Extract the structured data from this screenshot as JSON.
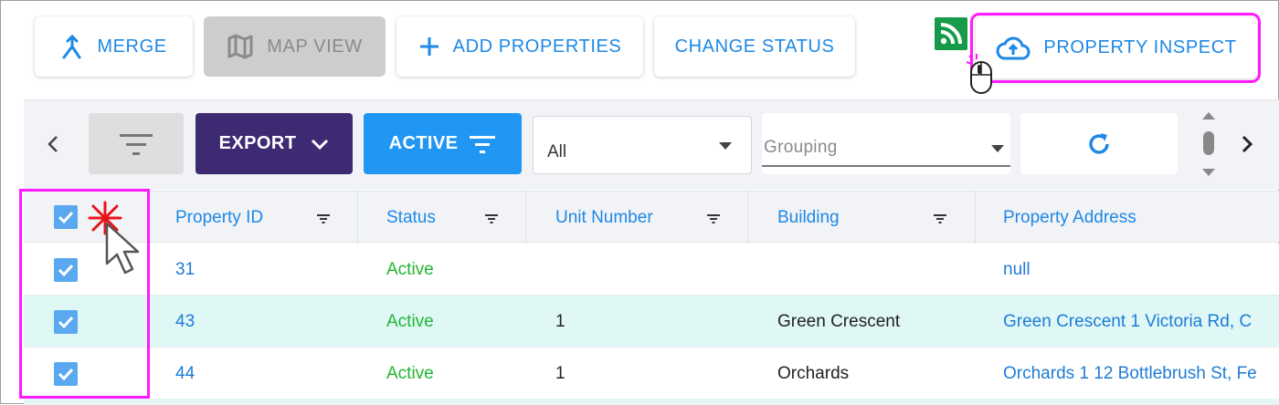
{
  "top_actions": {
    "merge": "MERGE",
    "map_view": "MAP VIEW",
    "add_properties": "ADD PROPERTIES",
    "change_status": "CHANGE STATUS",
    "property_inspect": "PROPERTY INSPECT"
  },
  "toolbar": {
    "export": "EXPORT",
    "active": "ACTIVE",
    "status_select_value": "All",
    "grouping_placeholder": "Grouping"
  },
  "table": {
    "headers": {
      "property_id": "Property ID",
      "status": "Status",
      "unit_number": "Unit Number",
      "building": "Building",
      "property_address": "Property Address"
    },
    "rows": [
      {
        "property_id": "31",
        "status": "Active",
        "unit_number": "",
        "building": "",
        "address": "null"
      },
      {
        "property_id": "43",
        "status": "Active",
        "unit_number": "1",
        "building": "Green Crescent",
        "address": "Green Crescent 1 Victoria Rd, C"
      },
      {
        "property_id": "44",
        "status": "Active",
        "unit_number": "1",
        "building": "Orchards",
        "address": "Orchards 1 12 Bottlebrush St, Fe"
      }
    ]
  },
  "colors": {
    "accent_blue": "#1e88e5",
    "export_purple": "#3e2a73",
    "active_blue": "#2196f3",
    "status_green": "#21b531",
    "highlight_magenta": "#ff1aff",
    "row_highlight": "#dff8f6"
  },
  "icons": {
    "merge": "merge-icon",
    "map": "map-icon",
    "add": "plus-icon",
    "upload": "cloud-upload-icon",
    "rss": "rss-icon",
    "filter": "filter-icon",
    "refresh": "refresh-icon"
  }
}
